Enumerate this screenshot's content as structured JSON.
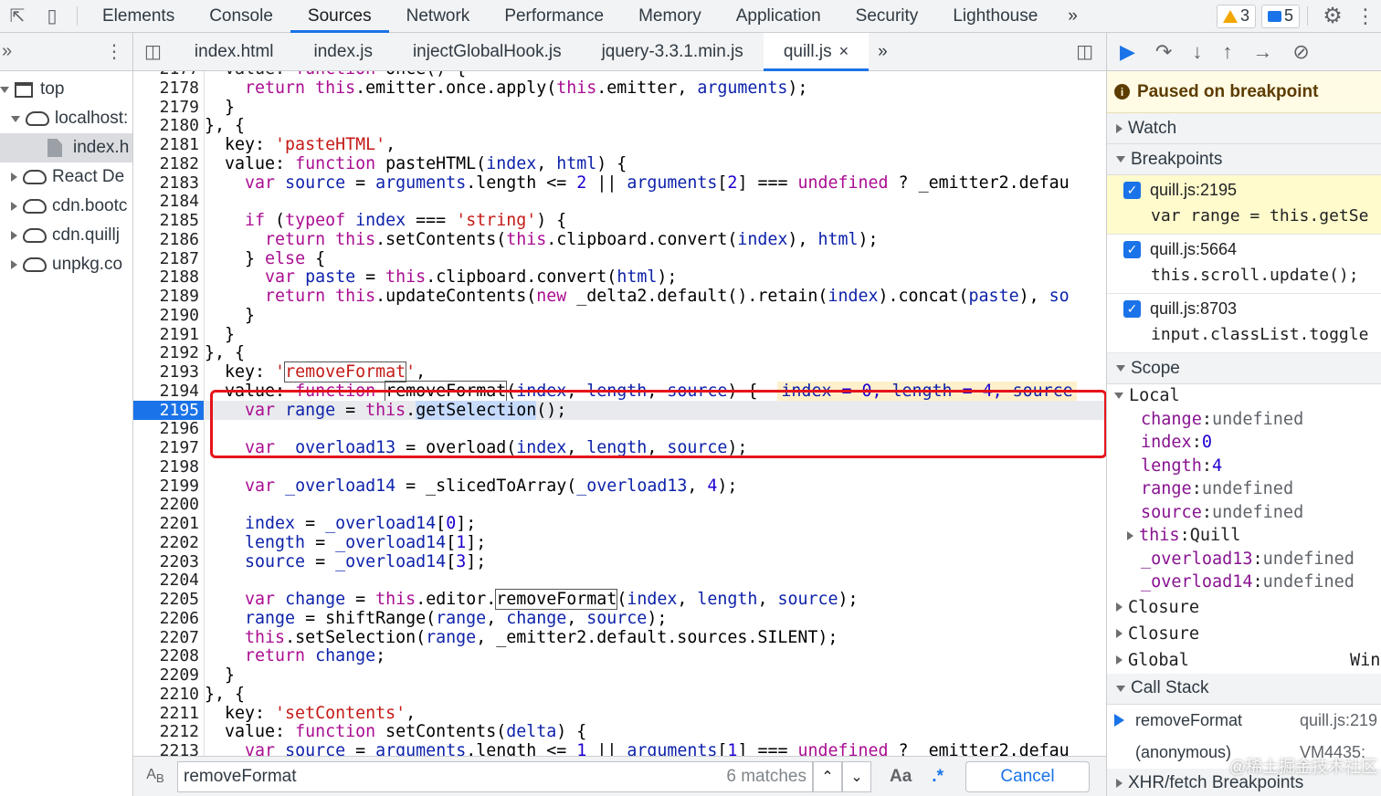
{
  "devtools": {
    "tabs": [
      "Elements",
      "Console",
      "Sources",
      "Network",
      "Performance",
      "Memory",
      "Application",
      "Security",
      "Lighthouse"
    ],
    "active_tab": "Sources",
    "more": "»",
    "warnings_count": "3",
    "messages_count": "5"
  },
  "navigator": {
    "items": [
      {
        "label": "top",
        "type": "frame",
        "indent": 0,
        "expanded": true
      },
      {
        "label": "localhost:",
        "type": "origin",
        "indent": 1,
        "expanded": true
      },
      {
        "label": "index.h",
        "type": "file",
        "indent": 2,
        "selected": true
      },
      {
        "label": "React De",
        "type": "origin",
        "indent": 1,
        "expanded": false
      },
      {
        "label": "cdn.bootc",
        "type": "origin",
        "indent": 1,
        "expanded": false
      },
      {
        "label": "cdn.quillj",
        "type": "origin",
        "indent": 1,
        "expanded": false
      },
      {
        "label": "unpkg.co",
        "type": "origin",
        "indent": 1,
        "expanded": false
      }
    ]
  },
  "editor": {
    "file_tabs": [
      "index.html",
      "index.js",
      "injectGlobalHook.js",
      "jquery-3.3.1.min.js",
      "quill.js"
    ],
    "active_file": "quill.js",
    "first_line_partial": "  value: function once() {",
    "paused_line": 2195
  },
  "find": {
    "query": "removeFormat",
    "matches": "6 matches",
    "match_case": "Aa",
    "regex": ".*",
    "cancel": "Cancel"
  },
  "debugger": {
    "paused_message": "Paused on breakpoint",
    "watch": "Watch",
    "breakpoints_title": "Breakpoints",
    "breakpoints": [
      {
        "location": "quill.js:2195",
        "code": "var range = this.getSe",
        "current": true
      },
      {
        "location": "quill.js:5664",
        "code": "this.scroll.update();",
        "current": false
      },
      {
        "location": "quill.js:8703",
        "code": "input.classList.toggle",
        "current": false
      }
    ],
    "scope_title": "Scope",
    "local_title": "Local",
    "local_vars": [
      {
        "name": "change",
        "value": "undefined",
        "kind": "undef"
      },
      {
        "name": "index",
        "value": "0",
        "kind": "num"
      },
      {
        "name": "length",
        "value": "4",
        "kind": "num"
      },
      {
        "name": "range",
        "value": "undefined",
        "kind": "undef"
      },
      {
        "name": "source",
        "value": "undefined",
        "kind": "undef"
      },
      {
        "name": "this",
        "value": "Quill",
        "kind": "obj"
      },
      {
        "name": "_overload13",
        "value": "undefined",
        "kind": "undef"
      },
      {
        "name": "_overload14",
        "value": "undefined",
        "kind": "undef"
      }
    ],
    "closures": [
      "Closure",
      "Closure"
    ],
    "global": "Global",
    "global_value": "Win",
    "call_stack_title": "Call Stack",
    "call_stack": [
      {
        "fn": "removeFormat",
        "loc": "quill.js:219",
        "current": true
      },
      {
        "fn": "(anonymous)",
        "loc": "VM4435:",
        "current": false
      }
    ],
    "xhr_title": "XHR/fetch Breakpoints"
  },
  "watermark": "@稀土掘金技术社区"
}
